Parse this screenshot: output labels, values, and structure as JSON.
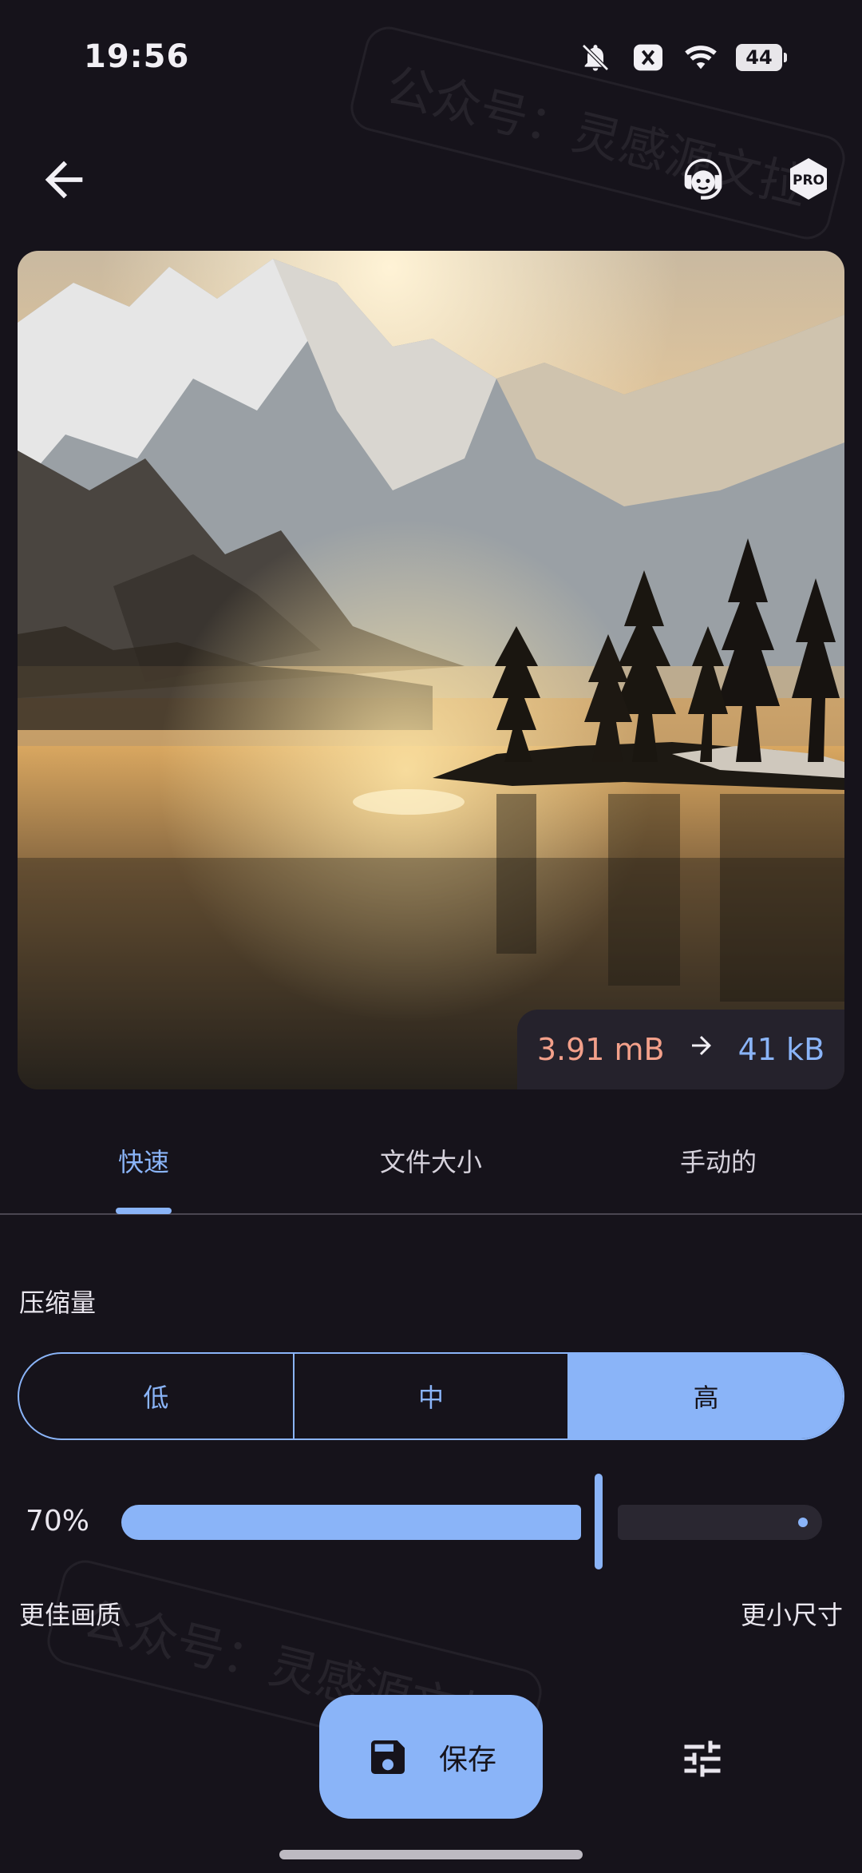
{
  "status_bar": {
    "time": "19:56",
    "battery": "44"
  },
  "header": {
    "back_icon": "arrow-left-icon",
    "support_icon": "support-agent-icon",
    "pro_label": "PRO"
  },
  "photo": {
    "description_icon": "landscape-image",
    "size_before": "3.91 mB",
    "size_after": "41 kB"
  },
  "tabs": [
    {
      "label": "快速",
      "active": true
    },
    {
      "label": "文件大小",
      "active": false
    },
    {
      "label": "手动的",
      "active": false
    }
  ],
  "compression": {
    "label": "压缩量",
    "options": [
      {
        "label": "低",
        "active": false
      },
      {
        "label": "中",
        "active": false
      },
      {
        "label": "高",
        "active": true
      }
    ],
    "percent": "70%",
    "slider_value": 0.7,
    "left_label": "更佳画质",
    "right_label": "更小尺寸"
  },
  "actions": {
    "save_label": "保存"
  },
  "watermark": "公众号：灵感源文拉",
  "colors": {
    "accent": "#8ab4f8",
    "background": "#16131b",
    "old_size": "#f3a08a"
  }
}
